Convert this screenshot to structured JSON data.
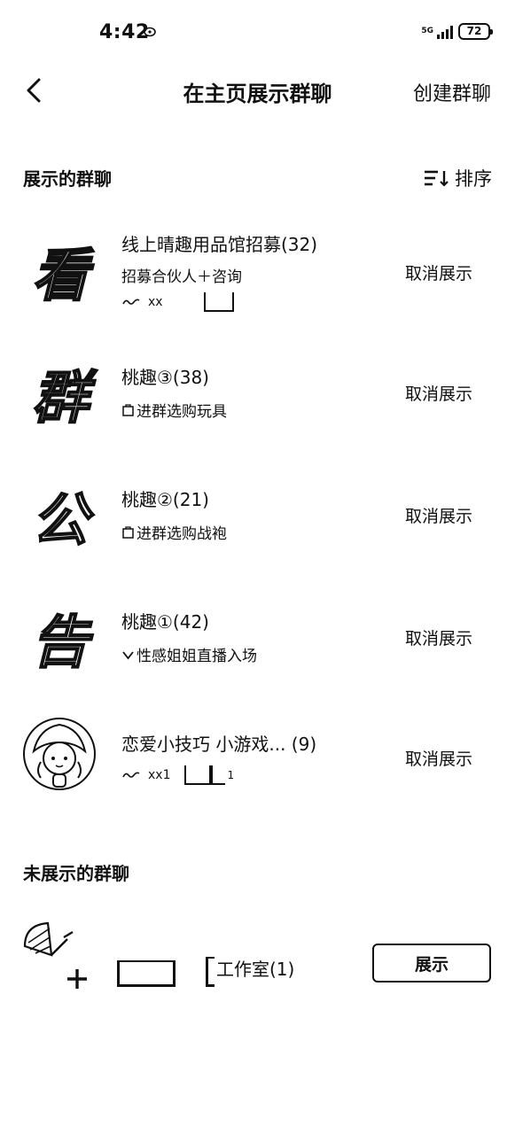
{
  "status_bar": {
    "time": "4:42",
    "network": "5G",
    "battery": "72"
  },
  "nav": {
    "title": "在主页展示群聊",
    "action": "创建群聊"
  },
  "shown_section": {
    "title": "展示的群聊",
    "sort_label": "排序",
    "action_label": "取消展示",
    "groups": [
      {
        "avatar_char": "看",
        "name": "线上晴趣用品馆招募(32)",
        "subtitle": "招募合伙人＋咨询",
        "line3": "xx"
      },
      {
        "avatar_char": "群",
        "name": "桃趣③(38)",
        "subtitle": "进群选购玩具"
      },
      {
        "avatar_char": "公",
        "name": "桃趣②(21)",
        "subtitle": "进群选购战袍"
      },
      {
        "avatar_char": "告",
        "name": "桃趣①(42)",
        "subtitle": "性感姐姐直播入场"
      },
      {
        "avatar_char": "",
        "name": "恋爱小技巧 小游戏... (9)",
        "line3": "xx1",
        "line3_suffix": "1"
      }
    ]
  },
  "hidden_section": {
    "title": "未展示的群聊",
    "action_label": "展示",
    "groups": [
      {
        "name": "工作室(1)"
      }
    ]
  }
}
